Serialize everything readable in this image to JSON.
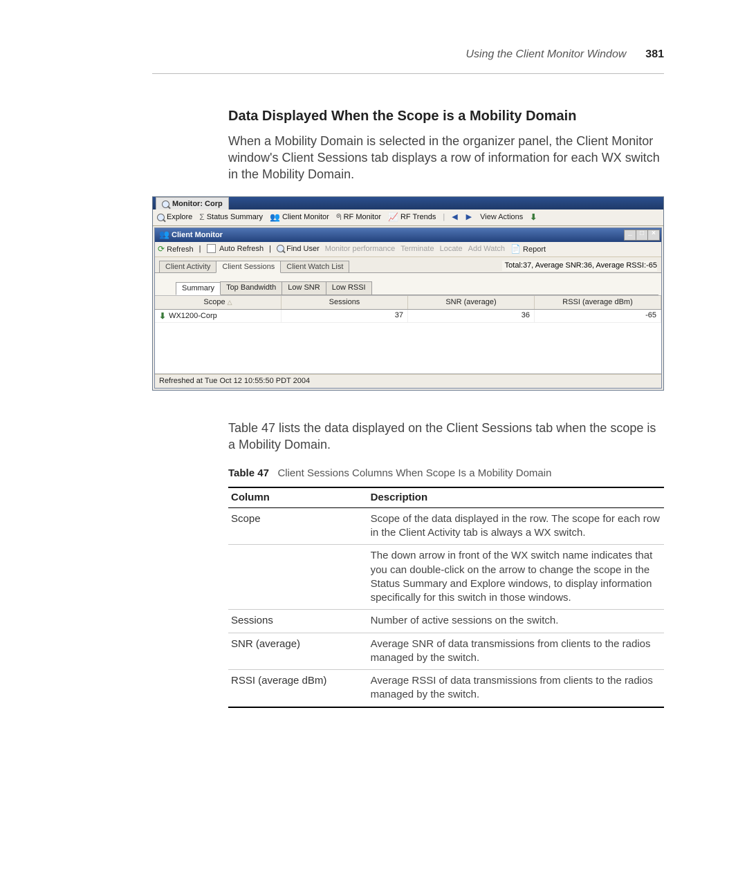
{
  "page_header": {
    "title": "Using the Client Monitor Window",
    "page_number": "381"
  },
  "section": {
    "heading": "Data Displayed When the Scope is a Mobility Domain",
    "paragraph": "When a Mobility Domain is selected in the organizer panel, the Client Monitor window's Client Sessions tab displays a row of information for each WX switch in the Mobility Domain."
  },
  "screenshot": {
    "outer_window_title": "Monitor: Corp",
    "navbar": {
      "explore": "Explore",
      "status_summary": "Status Summary",
      "client_monitor": "Client Monitor",
      "rf_monitor": "RF Monitor",
      "rf_trends": "RF Trends",
      "view_actions": "View Actions"
    },
    "inner_window_title": "Client Monitor",
    "toolbar": {
      "refresh": "Refresh",
      "auto_refresh": "Auto Refresh",
      "find_user": "Find User",
      "monitor_performance": "Monitor performance",
      "terminate": "Terminate",
      "locate": "Locate",
      "add_watch": "Add Watch",
      "report": "Report"
    },
    "main_tabs": {
      "client_activity": "Client Activity",
      "client_sessions": "Client Sessions",
      "client_watch_list": "Client Watch List"
    },
    "stats_line": "Total:37, Average SNR:36, Average RSSI:-65",
    "sub_tabs": {
      "summary": "Summary",
      "top_bandwidth": "Top Bandwidth",
      "low_snr": "Low SNR",
      "low_rssi": "Low RSSI"
    },
    "grid": {
      "headers": {
        "scope": "Scope",
        "sessions": "Sessions",
        "snr": "SNR (average)",
        "rssi": "RSSI (average dBm)"
      },
      "rows": [
        {
          "scope": "WX1200-Corp",
          "sessions": "37",
          "snr": "36",
          "rssi": "-65"
        }
      ]
    },
    "status_line": "Refreshed at Tue Oct 12 10:55:50 PDT 2004"
  },
  "after_screenshot_para": "Table 47 lists the data displayed on the Client Sessions tab when the scope is a Mobility Domain.",
  "table47": {
    "caption_label": "Table 47",
    "caption_text": "Client Sessions Columns When Scope Is a Mobility Domain",
    "head": {
      "c1": "Column",
      "c2": "Description"
    },
    "rows": [
      {
        "c1": "Scope",
        "c2": "Scope of the data displayed in the row. The scope for each row in the Client Activity tab is always a WX switch."
      },
      {
        "c1": "",
        "c2": "The down arrow in front of the WX switch name indicates that you can double-click on the arrow to change the scope in the Status Summary and Explore windows, to display information specifically for this switch in those windows."
      },
      {
        "c1": "Sessions",
        "c2": "Number of active sessions on the switch."
      },
      {
        "c1": "SNR (average)",
        "c2": "Average SNR of data transmissions from clients to the radios managed by the switch."
      },
      {
        "c1": "RSSI (average dBm)",
        "c2": "Average RSSI of data transmissions from clients to the radios managed by the switch."
      }
    ]
  }
}
